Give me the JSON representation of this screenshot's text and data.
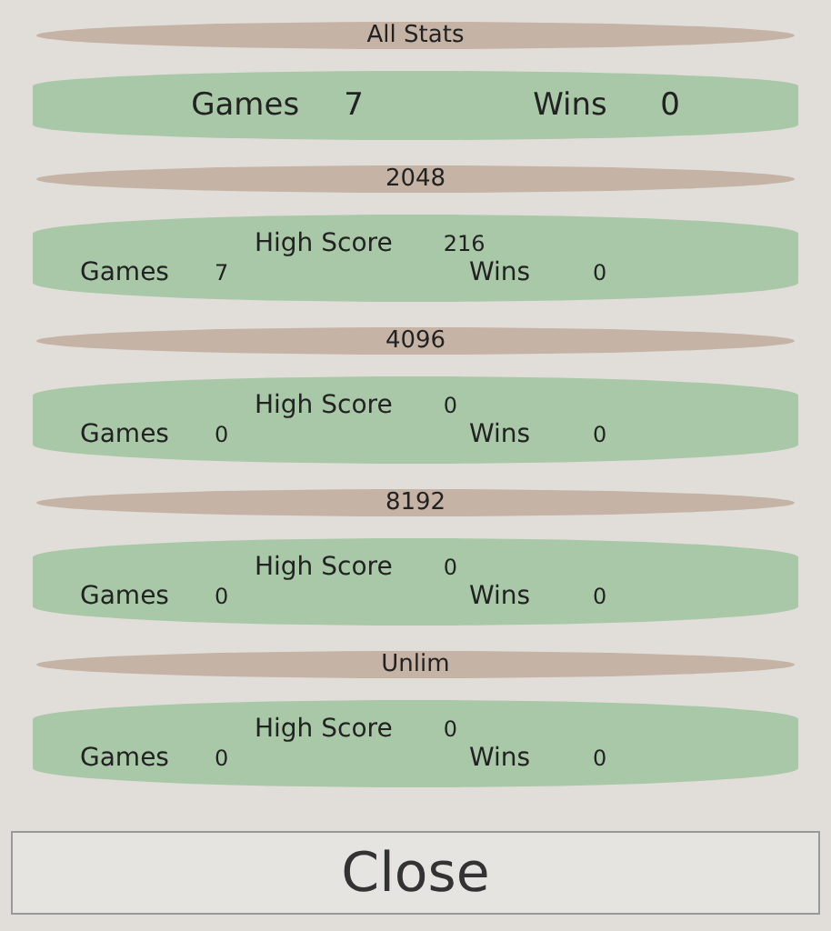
{
  "sections": [
    {
      "title": "All Stats",
      "kind": "summary",
      "games_label": "Games",
      "games": "7",
      "wins_label": "Wins",
      "wins": "0"
    },
    {
      "title": "2048",
      "kind": "detail",
      "high_score_label": "High Score",
      "high_score": "216",
      "games_label": "Games",
      "games": "7",
      "wins_label": "Wins",
      "wins": "0"
    },
    {
      "title": "4096",
      "kind": "detail",
      "high_score_label": "High Score",
      "high_score": "0",
      "games_label": "Games",
      "games": "0",
      "wins_label": "Wins",
      "wins": "0"
    },
    {
      "title": "8192",
      "kind": "detail",
      "high_score_label": "High Score",
      "high_score": "0",
      "games_label": "Games",
      "games": "0",
      "wins_label": "Wins",
      "wins": "0"
    },
    {
      "title": "Unlim",
      "kind": "detail",
      "high_score_label": "High Score",
      "high_score": "0",
      "games_label": "Games",
      "games": "0",
      "wins_label": "Wins",
      "wins": "0"
    }
  ],
  "close_button": "Close"
}
